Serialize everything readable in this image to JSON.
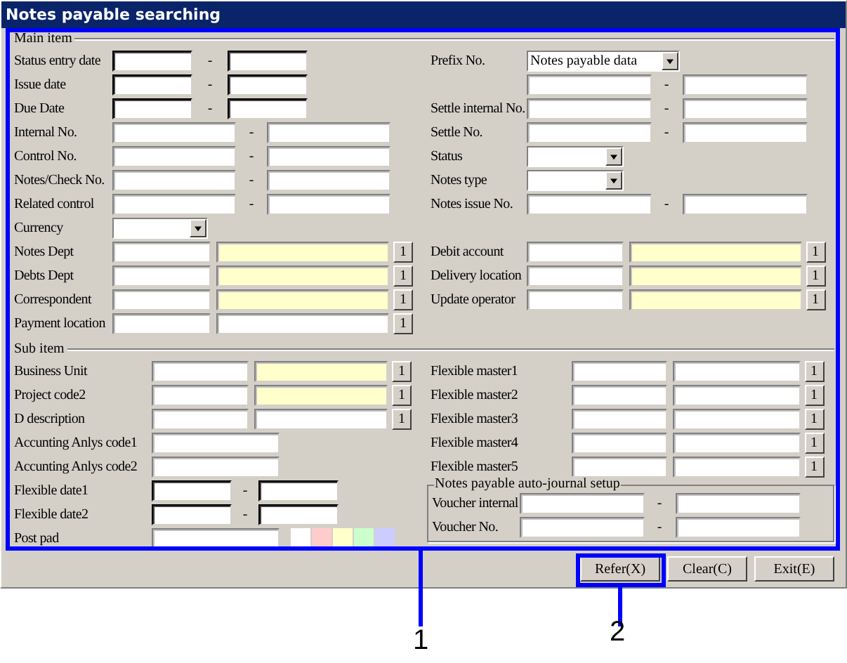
{
  "window": {
    "title": "Notes payable searching"
  },
  "main_item": {
    "title": "Main item",
    "left": [
      {
        "kind": "date",
        "label": "Status entry date",
        "separator": "-"
      },
      {
        "kind": "date",
        "label": "Issue date",
        "separator": "-"
      },
      {
        "kind": "date",
        "label": "Due Date",
        "separator": "-"
      },
      {
        "kind": "range",
        "label": "Internal No.",
        "separator": "-"
      },
      {
        "kind": "range",
        "label": "Control No.",
        "separator": "-"
      },
      {
        "kind": "range",
        "label": "Notes/Check No.",
        "separator": "-"
      },
      {
        "kind": "range",
        "label": "Related control",
        "separator": "-"
      },
      {
        "kind": "select",
        "label": "Currency"
      },
      {
        "kind": "lookup",
        "label": "Notes Dept",
        "readonly": true,
        "button": "1"
      },
      {
        "kind": "lookup",
        "label": "Debts Dept",
        "readonly": true,
        "button": "1"
      },
      {
        "kind": "lookup",
        "label": "Correspondent",
        "readonly": true,
        "button": "1"
      },
      {
        "kind": "lookup",
        "label": "Payment location",
        "readonly": false,
        "button": "1"
      }
    ],
    "right": [
      {
        "kind": "select",
        "label": "Prefix No.",
        "value": "Notes payable data"
      },
      {
        "kind": "range",
        "separator": "-"
      },
      {
        "kind": "range",
        "label": "Settle internal No.",
        "separator": "-"
      },
      {
        "kind": "range",
        "label": "Settle No.",
        "separator": "-"
      },
      {
        "kind": "select",
        "label": "Status"
      },
      {
        "kind": "select",
        "label": "Notes type"
      },
      {
        "kind": "range",
        "label": "Notes issue No.",
        "separator": "-"
      },
      {
        "kind": "lookup",
        "label": "Debit account",
        "readonly": true,
        "button": "1"
      },
      {
        "kind": "lookup",
        "label": "Delivery location",
        "readonly": true,
        "button": "1"
      },
      {
        "kind": "lookup",
        "label": "Update operator",
        "readonly": true,
        "button": "1"
      }
    ]
  },
  "sub_item": {
    "title": "Sub item",
    "left": [
      {
        "kind": "lookup",
        "label": "Business Unit",
        "readonly": true,
        "button": "1"
      },
      {
        "kind": "lookup",
        "label": "Project code2",
        "readonly": true,
        "button": "1"
      },
      {
        "kind": "lookup",
        "label": "D description",
        "readonly": false,
        "button": "1"
      },
      {
        "kind": "single",
        "label": "Accunting Anlys code1"
      },
      {
        "kind": "single",
        "label": "Accunting Anlys code2"
      },
      {
        "kind": "date",
        "label": "Flexible date1",
        "separator": "-"
      },
      {
        "kind": "date",
        "label": "Flexible date2",
        "separator": "-"
      },
      {
        "kind": "single",
        "label": "Post pad",
        "swatches": [
          {
            "color": "#ffffff"
          },
          {
            "color": "#ffcccc"
          },
          {
            "color": "#ffffcc"
          },
          {
            "color": "#ccffcc"
          },
          {
            "color": "#ccccff"
          }
        ]
      }
    ],
    "right": [
      {
        "kind": "lookup",
        "label": "Flexible master1",
        "readonly": false,
        "button": "1"
      },
      {
        "kind": "lookup",
        "label": "Flexible master2",
        "readonly": false,
        "button": "1"
      },
      {
        "kind": "lookup",
        "label": "Flexible master3",
        "readonly": false,
        "button": "1"
      },
      {
        "kind": "lookup",
        "label": "Flexible master4",
        "readonly": false,
        "button": "1"
      },
      {
        "kind": "lookup",
        "label": "Flexible master5",
        "readonly": false,
        "button": "1"
      }
    ],
    "auto_journal": {
      "title": "Notes payable auto-journal setup",
      "rows": [
        {
          "kind": "range",
          "label": "Voucher internal",
          "separator": "-"
        },
        {
          "kind": "range",
          "label": "Voucher No.",
          "separator": "-"
        }
      ]
    }
  },
  "buttons": [
    {
      "label": "Refer(X)"
    },
    {
      "label": "Clear(C)"
    },
    {
      "label": "Exit(E)"
    }
  ],
  "callouts": [
    {
      "label": "1"
    },
    {
      "label": "2"
    }
  ]
}
